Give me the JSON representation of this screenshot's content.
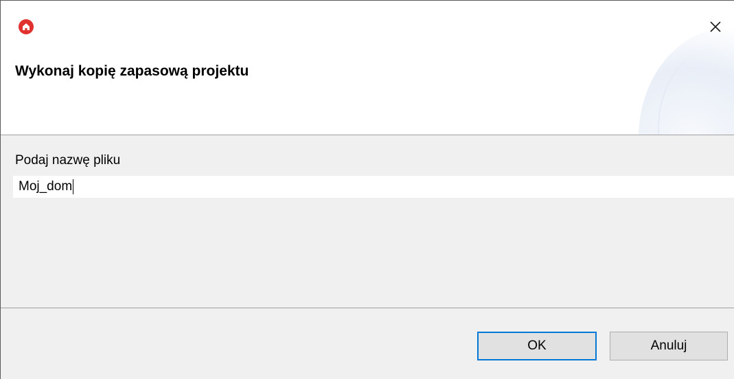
{
  "window": {
    "title": "Wykonaj kopię zapasową projektu",
    "app_icon": "home-icon",
    "close_icon": "close-icon",
    "close_symbol": "✕"
  },
  "form": {
    "label": "Podaj nazwę pliku",
    "value": "Moj_dom"
  },
  "buttons": {
    "ok": "OK",
    "cancel": "Anuluj"
  },
  "colors": {
    "accent": "#0078d7",
    "app_icon": "#e0312f"
  }
}
